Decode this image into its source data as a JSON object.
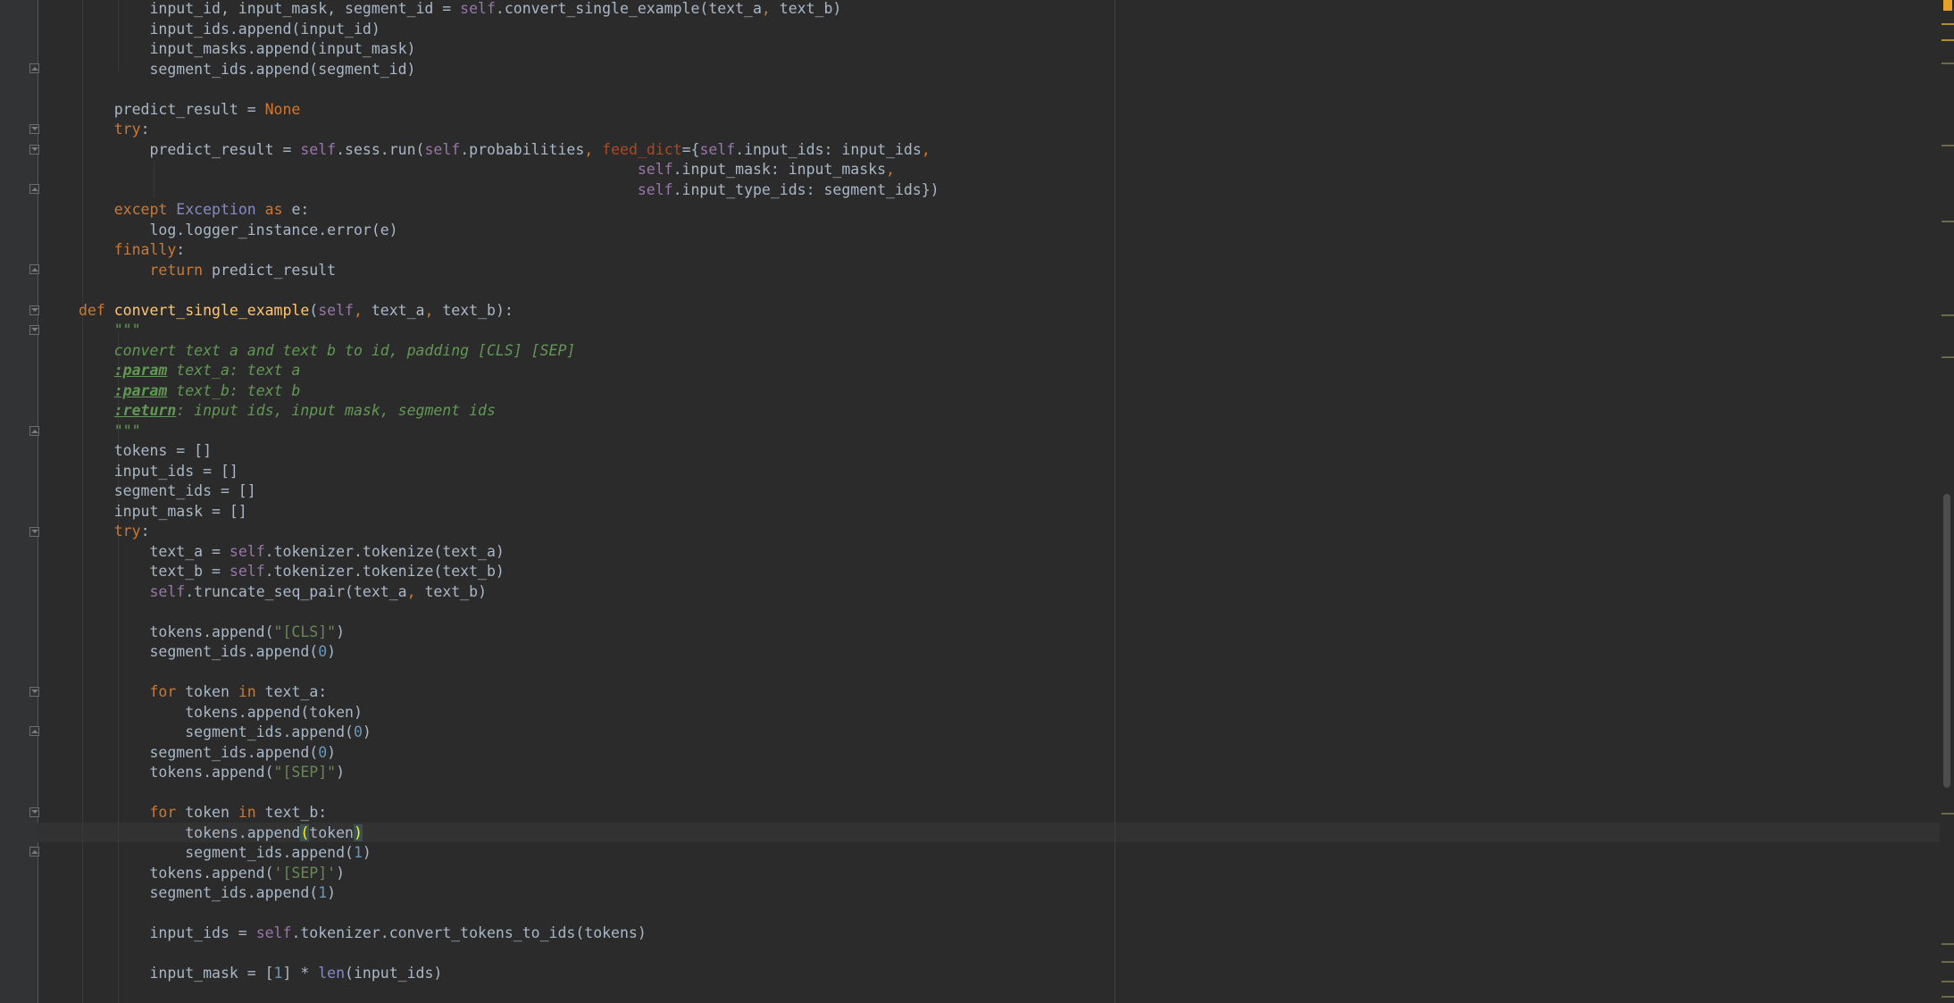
{
  "editor": {
    "language": "python",
    "lines": [
      [
        {
          "t": "        input_id, input_mask, segment_id = "
        },
        {
          "t": "self",
          "c": "s"
        },
        {
          "t": ".convert_single_example(text_a"
        },
        {
          "t": ", ",
          "c": "k"
        },
        {
          "t": "text_b)"
        }
      ],
      [
        {
          "t": "        input_ids.append(input_id)"
        }
      ],
      [
        {
          "t": "        input_masks.append(input_mask)"
        }
      ],
      [
        {
          "t": "        segment_ids.append(segment_id)"
        }
      ],
      [
        {
          "t": ""
        }
      ],
      [
        {
          "t": "    predict_result = "
        },
        {
          "t": "None",
          "c": "k"
        }
      ],
      [
        {
          "t": "    "
        },
        {
          "t": "try",
          "c": "k"
        },
        {
          "t": ":"
        }
      ],
      [
        {
          "t": "        predict_result = "
        },
        {
          "t": "self",
          "c": "s"
        },
        {
          "t": ".sess.run("
        },
        {
          "t": "self",
          "c": "s"
        },
        {
          "t": ".probabilities"
        },
        {
          "t": ", ",
          "c": "k"
        },
        {
          "t": "feed_dict",
          "c": "param"
        },
        {
          "t": "={"
        },
        {
          "t": "self",
          "c": "s"
        },
        {
          "t": ".input_ids: input_ids"
        },
        {
          "t": ",",
          "c": "k"
        }
      ],
      [
        {
          "t": "                                                               "
        },
        {
          "t": "self",
          "c": "s"
        },
        {
          "t": ".input_mask: input_masks"
        },
        {
          "t": ",",
          "c": "k"
        }
      ],
      [
        {
          "t": "                                                               "
        },
        {
          "t": "self",
          "c": "s"
        },
        {
          "t": ".input_type_ids: segment_ids})"
        }
      ],
      [
        {
          "t": "    "
        },
        {
          "t": "except ",
          "c": "k"
        },
        {
          "t": "Exception",
          "c": "cls"
        },
        {
          "t": " as ",
          "c": "k"
        },
        {
          "t": "e:"
        }
      ],
      [
        {
          "t": "        log.logger_instance.error(e)"
        }
      ],
      [
        {
          "t": "    "
        },
        {
          "t": "finally",
          "c": "k"
        },
        {
          "t": ":"
        }
      ],
      [
        {
          "t": "        "
        },
        {
          "t": "return ",
          "c": "k"
        },
        {
          "t": "predict_result"
        }
      ],
      [
        {
          "t": ""
        }
      ],
      [
        {
          "t": "def ",
          "c": "k"
        },
        {
          "t": "convert_single_example",
          "c": "fn"
        },
        {
          "t": "("
        },
        {
          "t": "self",
          "c": "s"
        },
        {
          "t": ", ",
          "c": "k"
        },
        {
          "t": "text_a"
        },
        {
          "t": ", ",
          "c": "k"
        },
        {
          "t": "text_b):"
        }
      ],
      [
        {
          "t": "    "
        },
        {
          "t": "\"\"\"",
          "c": "doc"
        }
      ],
      [
        {
          "t": "    "
        },
        {
          "t": "convert text a and text b to id, padding [CLS] [SEP]",
          "c": "doc"
        }
      ],
      [
        {
          "t": "    "
        },
        {
          "t": ":param",
          "c": "tag"
        },
        {
          "t": " text_a: text a",
          "c": "doc"
        }
      ],
      [
        {
          "t": "    "
        },
        {
          "t": ":param",
          "c": "tag"
        },
        {
          "t": " text_b: text b",
          "c": "doc"
        }
      ],
      [
        {
          "t": "    "
        },
        {
          "t": ":return",
          "c": "tag"
        },
        {
          "t": ": input ids, input mask, segment ids",
          "c": "doc"
        }
      ],
      [
        {
          "t": "    "
        },
        {
          "t": "\"\"\"",
          "c": "doc"
        }
      ],
      [
        {
          "t": "    tokens = []"
        }
      ],
      [
        {
          "t": "    input_ids = []"
        }
      ],
      [
        {
          "t": "    segment_ids = []"
        }
      ],
      [
        {
          "t": "    input_mask = []"
        }
      ],
      [
        {
          "t": "    "
        },
        {
          "t": "try",
          "c": "k"
        },
        {
          "t": ":"
        }
      ],
      [
        {
          "t": "        text_a = "
        },
        {
          "t": "self",
          "c": "s"
        },
        {
          "t": ".tokenizer.tokenize(text_a)"
        }
      ],
      [
        {
          "t": "        text_b = "
        },
        {
          "t": "self",
          "c": "s"
        },
        {
          "t": ".tokenizer.tokenize(text_b)"
        }
      ],
      [
        {
          "t": "        "
        },
        {
          "t": "self",
          "c": "s"
        },
        {
          "t": ".truncate_seq_pair(text_a"
        },
        {
          "t": ", ",
          "c": "k"
        },
        {
          "t": "text_b)"
        }
      ],
      [
        {
          "t": ""
        }
      ],
      [
        {
          "t": "        tokens.append("
        },
        {
          "t": "\"[CLS]\"",
          "c": "str"
        },
        {
          "t": ")"
        }
      ],
      [
        {
          "t": "        segment_ids.append("
        },
        {
          "t": "0",
          "c": "n"
        },
        {
          "t": ")"
        }
      ],
      [
        {
          "t": ""
        }
      ],
      [
        {
          "t": "        "
        },
        {
          "t": "for ",
          "c": "k"
        },
        {
          "t": "token "
        },
        {
          "t": "in ",
          "c": "k"
        },
        {
          "t": "text_a:"
        }
      ],
      [
        {
          "t": "            tokens.append(token)"
        }
      ],
      [
        {
          "t": "            segment_ids.append("
        },
        {
          "t": "0",
          "c": "n"
        },
        {
          "t": ")"
        }
      ],
      [
        {
          "t": "        segment_ids.append("
        },
        {
          "t": "0",
          "c": "n"
        },
        {
          "t": ")"
        }
      ],
      [
        {
          "t": "        tokens.append("
        },
        {
          "t": "\"[SEP]\"",
          "c": "str"
        },
        {
          "t": ")"
        }
      ],
      [
        {
          "t": ""
        }
      ],
      [
        {
          "t": "        "
        },
        {
          "t": "for ",
          "c": "k"
        },
        {
          "t": "token "
        },
        {
          "t": "in ",
          "c": "k"
        },
        {
          "t": "text_b:"
        }
      ],
      [
        {
          "t": "            tokens.append"
        },
        {
          "t": "(",
          "c": "match"
        },
        {
          "t": "token"
        },
        {
          "t": ")",
          "c": "match"
        }
      ],
      [
        {
          "t": "            segment_ids.append("
        },
        {
          "t": "1",
          "c": "n"
        },
        {
          "t": ")"
        }
      ],
      [
        {
          "t": "        tokens.append("
        },
        {
          "t": "'[SEP]'",
          "c": "str"
        },
        {
          "t": ")"
        }
      ],
      [
        {
          "t": "        segment_ids.append("
        },
        {
          "t": "1",
          "c": "n"
        },
        {
          "t": ")"
        }
      ],
      [
        {
          "t": ""
        }
      ],
      [
        {
          "t": "        input_ids = "
        },
        {
          "t": "self",
          "c": "s"
        },
        {
          "t": ".tokenizer.convert_tokens_to_ids(tokens)"
        }
      ],
      [
        {
          "t": ""
        }
      ],
      [
        {
          "t": "        input_mask = ["
        },
        {
          "t": "1",
          "c": "n"
        },
        {
          "t": "] * "
        },
        {
          "t": "len",
          "c": "cls"
        },
        {
          "t": "(input_ids)"
        }
      ]
    ]
  },
  "gutter": {
    "intention_icon": "lightbulb-icon"
  },
  "colors": {
    "background": "#2b2b2b",
    "keyword": "#cc7832",
    "self": "#9876aa",
    "number": "#6897bb",
    "string": "#6a8759",
    "function": "#ffc66d",
    "docstring": "#629755",
    "identifier": "#a9b7c6"
  }
}
